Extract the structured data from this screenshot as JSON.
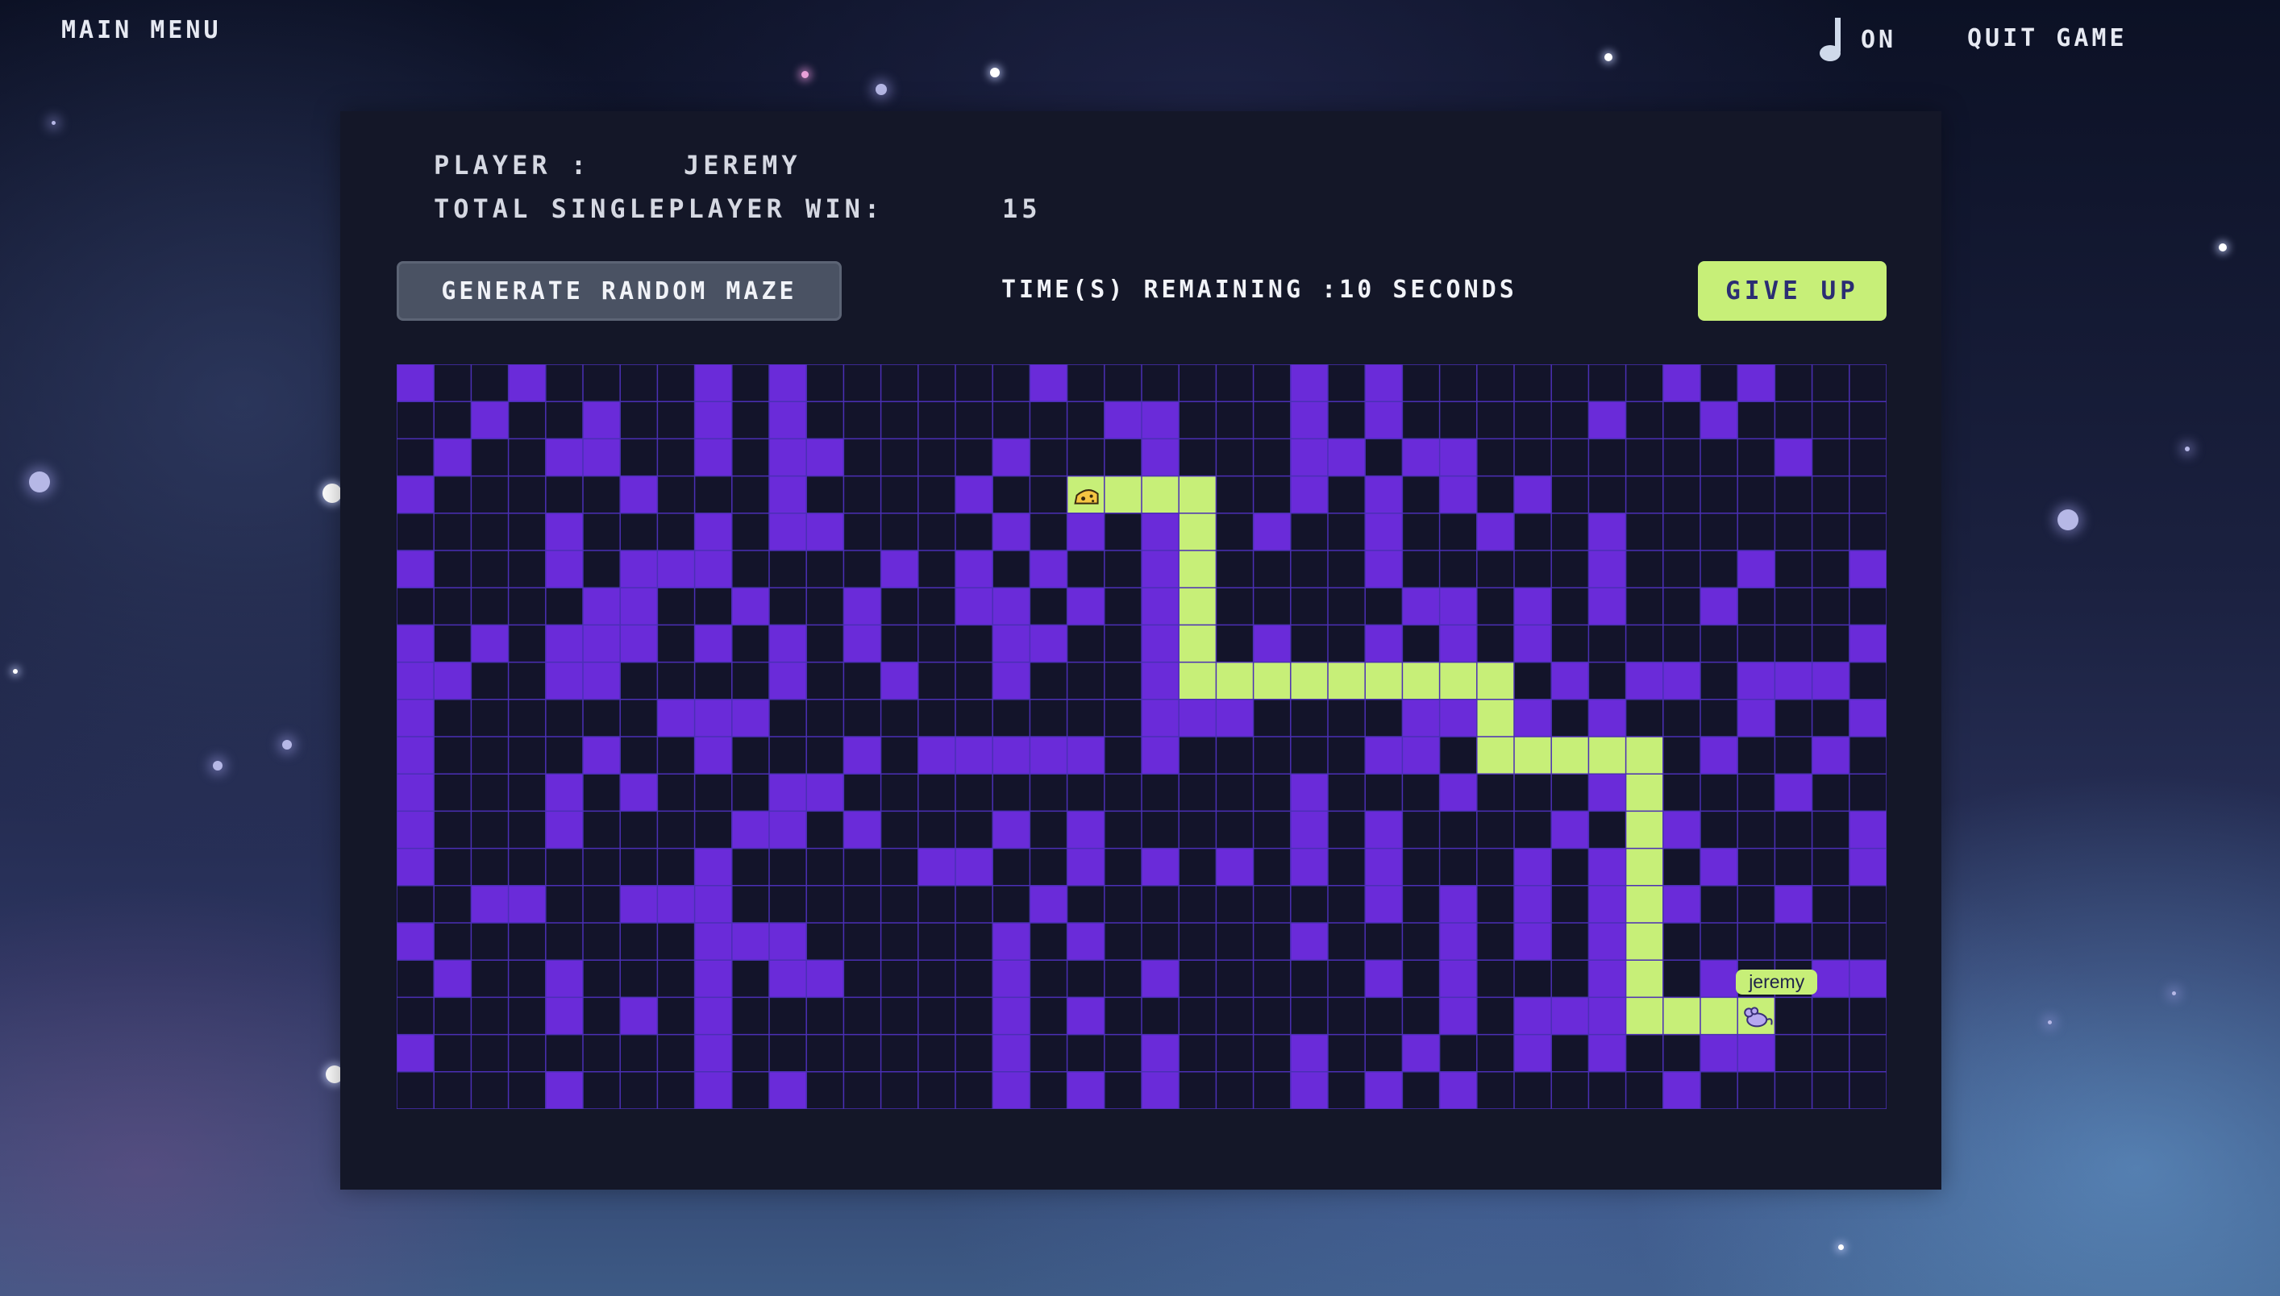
{
  "nav": {
    "main_menu_label": "MAIN MENU",
    "music_state": "ON",
    "quit_label": "QUIT GAME"
  },
  "player": {
    "player_label": "PLAYER :",
    "name": "JEREMY",
    "wins_label": "TOTAL SINGLEPLAYER WIN:",
    "wins": "15"
  },
  "controls": {
    "generate_label": "GENERATE RANDOM MAZE",
    "timer_text": "TIME(S) REMAINING :10 SECONDS",
    "give_up_label": "GIVE UP"
  },
  "maze": {
    "cols": 40,
    "rows": 20,
    "colors": {
      "wall": "#6a2bd9",
      "floor": "#13142a",
      "grid_line": "#4b2fb5",
      "path": "#c7ef78"
    },
    "walls": [
      [
        0,
        0
      ],
      [
        3,
        0
      ],
      [
        8,
        0
      ],
      [
        10,
        0
      ],
      [
        17,
        0
      ],
      [
        24,
        0
      ],
      [
        26,
        0
      ],
      [
        34,
        0
      ],
      [
        36,
        0
      ],
      [
        2,
        1
      ],
      [
        5,
        1
      ],
      [
        8,
        1
      ],
      [
        10,
        1
      ],
      [
        19,
        1
      ],
      [
        20,
        1
      ],
      [
        24,
        1
      ],
      [
        26,
        1
      ],
      [
        32,
        1
      ],
      [
        35,
        1
      ],
      [
        1,
        2
      ],
      [
        4,
        2
      ],
      [
        5,
        2
      ],
      [
        8,
        2
      ],
      [
        10,
        2
      ],
      [
        11,
        2
      ],
      [
        16,
        2
      ],
      [
        20,
        2
      ],
      [
        24,
        2
      ],
      [
        25,
        2
      ],
      [
        27,
        2
      ],
      [
        28,
        2
      ],
      [
        37,
        2
      ],
      [
        0,
        3
      ],
      [
        6,
        3
      ],
      [
        10,
        3
      ],
      [
        15,
        3
      ],
      [
        24,
        3
      ],
      [
        26,
        3
      ],
      [
        28,
        3
      ],
      [
        30,
        3
      ],
      [
        4,
        4
      ],
      [
        8,
        4
      ],
      [
        10,
        4
      ],
      [
        11,
        4
      ],
      [
        16,
        4
      ],
      [
        18,
        4
      ],
      [
        20,
        4
      ],
      [
        23,
        4
      ],
      [
        26,
        4
      ],
      [
        29,
        4
      ],
      [
        32,
        4
      ],
      [
        0,
        5
      ],
      [
        4,
        5
      ],
      [
        6,
        5
      ],
      [
        7,
        5
      ],
      [
        8,
        5
      ],
      [
        13,
        5
      ],
      [
        15,
        5
      ],
      [
        17,
        5
      ],
      [
        20,
        5
      ],
      [
        26,
        5
      ],
      [
        32,
        5
      ],
      [
        36,
        5
      ],
      [
        39,
        5
      ],
      [
        5,
        6
      ],
      [
        6,
        6
      ],
      [
        9,
        6
      ],
      [
        12,
        6
      ],
      [
        15,
        6
      ],
      [
        16,
        6
      ],
      [
        18,
        6
      ],
      [
        20,
        6
      ],
      [
        27,
        6
      ],
      [
        28,
        6
      ],
      [
        30,
        6
      ],
      [
        32,
        6
      ],
      [
        35,
        6
      ],
      [
        0,
        7
      ],
      [
        2,
        7
      ],
      [
        4,
        7
      ],
      [
        5,
        7
      ],
      [
        6,
        7
      ],
      [
        8,
        7
      ],
      [
        10,
        7
      ],
      [
        12,
        7
      ],
      [
        16,
        7
      ],
      [
        17,
        7
      ],
      [
        20,
        7
      ],
      [
        23,
        7
      ],
      [
        26,
        7
      ],
      [
        28,
        7
      ],
      [
        30,
        7
      ],
      [
        39,
        7
      ],
      [
        0,
        8
      ],
      [
        1,
        8
      ],
      [
        4,
        8
      ],
      [
        5,
        8
      ],
      [
        10,
        8
      ],
      [
        13,
        8
      ],
      [
        16,
        8
      ],
      [
        20,
        8
      ],
      [
        31,
        8
      ],
      [
        33,
        8
      ],
      [
        34,
        8
      ],
      [
        36,
        8
      ],
      [
        37,
        8
      ],
      [
        38,
        8
      ],
      [
        0,
        9
      ],
      [
        7,
        9
      ],
      [
        8,
        9
      ],
      [
        9,
        9
      ],
      [
        20,
        9
      ],
      [
        21,
        9
      ],
      [
        22,
        9
      ],
      [
        27,
        9
      ],
      [
        28,
        9
      ],
      [
        30,
        9
      ],
      [
        32,
        9
      ],
      [
        36,
        9
      ],
      [
        39,
        9
      ],
      [
        0,
        10
      ],
      [
        5,
        10
      ],
      [
        8,
        10
      ],
      [
        12,
        10
      ],
      [
        14,
        10
      ],
      [
        15,
        10
      ],
      [
        16,
        10
      ],
      [
        17,
        10
      ],
      [
        18,
        10
      ],
      [
        20,
        10
      ],
      [
        26,
        10
      ],
      [
        27,
        10
      ],
      [
        35,
        10
      ],
      [
        38,
        10
      ],
      [
        0,
        11
      ],
      [
        4,
        11
      ],
      [
        6,
        11
      ],
      [
        10,
        11
      ],
      [
        11,
        11
      ],
      [
        24,
        11
      ],
      [
        28,
        11
      ],
      [
        32,
        11
      ],
      [
        37,
        11
      ],
      [
        0,
        12
      ],
      [
        4,
        12
      ],
      [
        9,
        12
      ],
      [
        10,
        12
      ],
      [
        12,
        12
      ],
      [
        16,
        12
      ],
      [
        18,
        12
      ],
      [
        24,
        12
      ],
      [
        26,
        12
      ],
      [
        31,
        12
      ],
      [
        34,
        12
      ],
      [
        39,
        12
      ],
      [
        0,
        13
      ],
      [
        8,
        13
      ],
      [
        14,
        13
      ],
      [
        15,
        13
      ],
      [
        18,
        13
      ],
      [
        20,
        13
      ],
      [
        22,
        13
      ],
      [
        24,
        13
      ],
      [
        26,
        13
      ],
      [
        30,
        13
      ],
      [
        32,
        13
      ],
      [
        35,
        13
      ],
      [
        39,
        13
      ],
      [
        2,
        14
      ],
      [
        3,
        14
      ],
      [
        6,
        14
      ],
      [
        7,
        14
      ],
      [
        8,
        14
      ],
      [
        17,
        14
      ],
      [
        26,
        14
      ],
      [
        28,
        14
      ],
      [
        30,
        14
      ],
      [
        32,
        14
      ],
      [
        34,
        14
      ],
      [
        37,
        14
      ],
      [
        0,
        15
      ],
      [
        8,
        15
      ],
      [
        9,
        15
      ],
      [
        10,
        15
      ],
      [
        16,
        15
      ],
      [
        18,
        15
      ],
      [
        24,
        15
      ],
      [
        28,
        15
      ],
      [
        30,
        15
      ],
      [
        32,
        15
      ],
      [
        1,
        16
      ],
      [
        4,
        16
      ],
      [
        8,
        16
      ],
      [
        10,
        16
      ],
      [
        11,
        16
      ],
      [
        16,
        16
      ],
      [
        20,
        16
      ],
      [
        26,
        16
      ],
      [
        28,
        16
      ],
      [
        32,
        16
      ],
      [
        35,
        16
      ],
      [
        38,
        16
      ],
      [
        39,
        16
      ],
      [
        4,
        17
      ],
      [
        6,
        17
      ],
      [
        8,
        17
      ],
      [
        16,
        17
      ],
      [
        18,
        17
      ],
      [
        28,
        17
      ],
      [
        30,
        17
      ],
      [
        31,
        17
      ],
      [
        32,
        17
      ],
      [
        0,
        18
      ],
      [
        8,
        18
      ],
      [
        16,
        18
      ],
      [
        20,
        18
      ],
      [
        24,
        18
      ],
      [
        27,
        18
      ],
      [
        30,
        18
      ],
      [
        32,
        18
      ],
      [
        35,
        18
      ],
      [
        36,
        18
      ],
      [
        4,
        19
      ],
      [
        8,
        19
      ],
      [
        10,
        19
      ],
      [
        16,
        19
      ],
      [
        18,
        19
      ],
      [
        20,
        19
      ],
      [
        24,
        19
      ],
      [
        26,
        19
      ],
      [
        28,
        19
      ],
      [
        34,
        19
      ]
    ],
    "path": [
      [
        18,
        3
      ],
      [
        19,
        3
      ],
      [
        20,
        3
      ],
      [
        21,
        3
      ],
      [
        21,
        4
      ],
      [
        21,
        5
      ],
      [
        21,
        6
      ],
      [
        21,
        7
      ],
      [
        21,
        8
      ],
      [
        22,
        8
      ],
      [
        23,
        8
      ],
      [
        24,
        8
      ],
      [
        25,
        8
      ],
      [
        26,
        8
      ],
      [
        27,
        8
      ],
      [
        28,
        8
      ],
      [
        29,
        8
      ],
      [
        29,
        9
      ],
      [
        29,
        10
      ],
      [
        30,
        10
      ],
      [
        31,
        10
      ],
      [
        32,
        10
      ],
      [
        33,
        10
      ],
      [
        33,
        11
      ],
      [
        33,
        12
      ],
      [
        33,
        13
      ],
      [
        33,
        14
      ],
      [
        33,
        15
      ],
      [
        33,
        16
      ],
      [
        33,
        17
      ],
      [
        34,
        17
      ],
      [
        35,
        17
      ],
      [
        36,
        17
      ]
    ],
    "goal_cell": [
      18,
      3
    ],
    "goal_icon": "cheese-icon",
    "player_cell": [
      36,
      17
    ],
    "player_icon": "mouse-icon",
    "player_tag": "jeremy"
  }
}
